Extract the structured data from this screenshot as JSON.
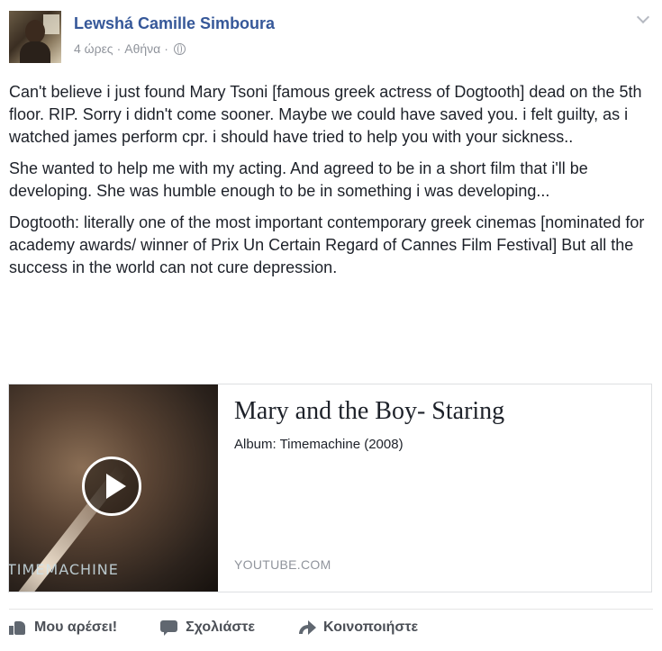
{
  "post": {
    "author": "Lewshá Camille Simboura",
    "time": "4 ώρες",
    "location": "Αθήνα",
    "separator": "·",
    "privacy_icon": "globe-icon",
    "paragraphs": [
      "Can't believe i just found Mary Tsoni [famous greek actress of Dogtooth] dead on the 5th floor. RIP. Sorry i didn't come sooner. Maybe we could have saved you. i felt guilty, as i watched james perform cpr. i should have tried to help you with your sickness..",
      "She wanted to help me with my acting. And agreed to be in a short film that i'll be developing. She was humble enough to be in something i was developing...",
      "Dogtooth: literally one of the most important contemporary greek cinemas [nominated for academy awards/ winner of Prix Un Certain Regard of Cannes Film Festival] But all the success in the world can not cure depression."
    ]
  },
  "link_card": {
    "title": "Mary and the Boy- Staring",
    "description": "Album: Timemachine (2008)",
    "domain": "YOUTUBE.COM",
    "thumbnail_caption": "TIMEMACHINE"
  },
  "actions": {
    "like": "Μου αρέσει!",
    "comment": "Σχολιάστε",
    "share": "Κοινοποιήστε"
  },
  "colors": {
    "author_link": "#365899",
    "meta_gray": "#90949c",
    "text": "#1d2129"
  }
}
